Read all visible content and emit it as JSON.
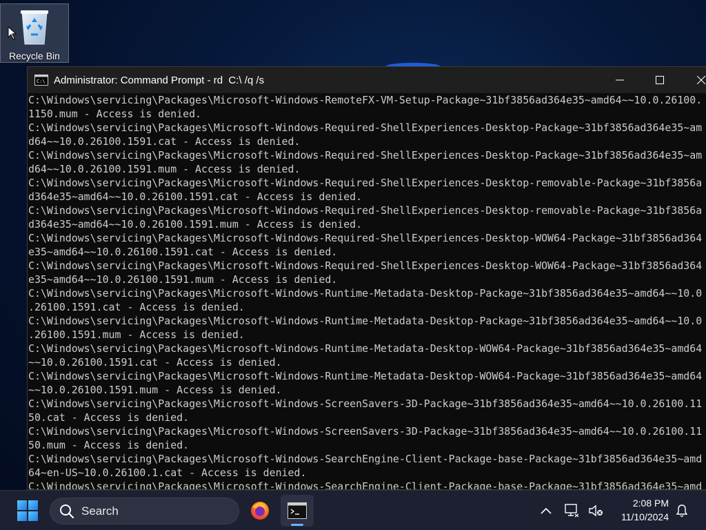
{
  "desktop": {
    "icons": [
      {
        "label": "Recycle Bin",
        "icon": "recycle-bin-icon"
      }
    ]
  },
  "window": {
    "title": "Administrator: Command Prompt - rd  C:\\ /q /s",
    "app_icon": "command-prompt-icon",
    "controls": {
      "minimize": "minimize-icon",
      "maximize": "maximize-icon",
      "close": "close-icon"
    },
    "lines": [
      "C:\\Windows\\servicing\\Packages\\Microsoft-Windows-RemoteFX-VM-Setup-Package~31bf3856ad364e35~amd64~~10.0.26100.",
      "1150.mum - Access is denied.",
      "C:\\Windows\\servicing\\Packages\\Microsoft-Windows-Required-ShellExperiences-Desktop-Package~31bf3856ad364e35~am",
      "d64~~10.0.26100.1591.cat - Access is denied.",
      "C:\\Windows\\servicing\\Packages\\Microsoft-Windows-Required-ShellExperiences-Desktop-Package~31bf3856ad364e35~am",
      "d64~~10.0.26100.1591.mum - Access is denied.",
      "C:\\Windows\\servicing\\Packages\\Microsoft-Windows-Required-ShellExperiences-Desktop-removable-Package~31bf3856a",
      "d364e35~amd64~~10.0.26100.1591.cat - Access is denied.",
      "C:\\Windows\\servicing\\Packages\\Microsoft-Windows-Required-ShellExperiences-Desktop-removable-Package~31bf3856a",
      "d364e35~amd64~~10.0.26100.1591.mum - Access is denied.",
      "C:\\Windows\\servicing\\Packages\\Microsoft-Windows-Required-ShellExperiences-Desktop-WOW64-Package~31bf3856ad364",
      "e35~amd64~~10.0.26100.1591.cat - Access is denied.",
      "C:\\Windows\\servicing\\Packages\\Microsoft-Windows-Required-ShellExperiences-Desktop-WOW64-Package~31bf3856ad364",
      "e35~amd64~~10.0.26100.1591.mum - Access is denied.",
      "C:\\Windows\\servicing\\Packages\\Microsoft-Windows-Runtime-Metadata-Desktop-Package~31bf3856ad364e35~amd64~~10.0",
      ".26100.1591.cat - Access is denied.",
      "C:\\Windows\\servicing\\Packages\\Microsoft-Windows-Runtime-Metadata-Desktop-Package~31bf3856ad364e35~amd64~~10.0",
      ".26100.1591.mum - Access is denied.",
      "C:\\Windows\\servicing\\Packages\\Microsoft-Windows-Runtime-Metadata-Desktop-WOW64-Package~31bf3856ad364e35~amd64",
      "~~10.0.26100.1591.cat - Access is denied.",
      "C:\\Windows\\servicing\\Packages\\Microsoft-Windows-Runtime-Metadata-Desktop-WOW64-Package~31bf3856ad364e35~amd64",
      "~~10.0.26100.1591.mum - Access is denied.",
      "C:\\Windows\\servicing\\Packages\\Microsoft-Windows-ScreenSavers-3D-Package~31bf3856ad364e35~amd64~~10.0.26100.11",
      "50.cat - Access is denied.",
      "C:\\Windows\\servicing\\Packages\\Microsoft-Windows-ScreenSavers-3D-Package~31bf3856ad364e35~amd64~~10.0.26100.11",
      "50.mum - Access is denied.",
      "C:\\Windows\\servicing\\Packages\\Microsoft-Windows-SearchEngine-Client-Package-base-Package~31bf3856ad364e35~amd",
      "64~en-US~10.0.26100.1.cat - Access is denied.",
      "C:\\Windows\\servicing\\Packages\\Microsoft-Windows-SearchEngine-Client-Package-base-Package~31bf3856ad364e35~amd"
    ]
  },
  "taskbar": {
    "start_icon": "windows-start-icon",
    "search_label": "Search",
    "apps": [
      {
        "name": "Firefox",
        "icon": "firefox-icon",
        "active": false
      },
      {
        "name": "Command Prompt",
        "icon": "command-prompt-icon",
        "active": true
      }
    ],
    "tray": [
      "chevron-up-icon",
      "network-icon",
      "volume-muted-icon",
      "notification-bell-icon"
    ],
    "time": "2:08 PM",
    "date": "11/10/2024"
  },
  "colors": {
    "console_bg": "#0c0c0c",
    "console_text": "#cccccc",
    "titlebar": "#1f1f1f",
    "taskbar": "#1c2030",
    "accent": "#6fb1ff"
  }
}
